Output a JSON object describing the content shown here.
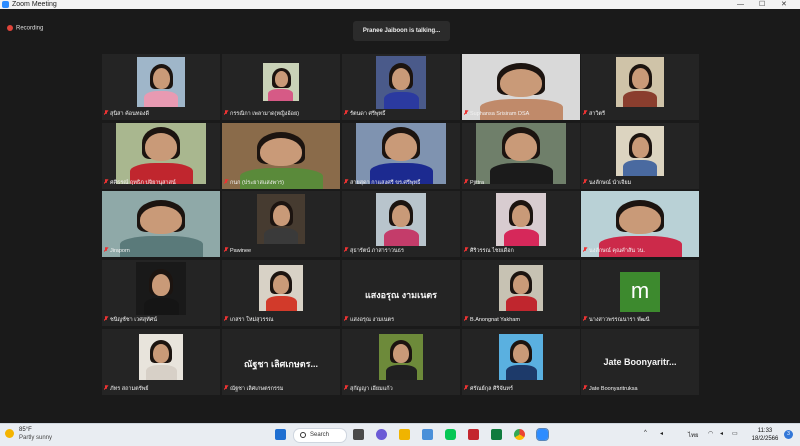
{
  "window": {
    "title": "Zoom Meeting",
    "controls": [
      "—",
      "☐",
      "✕"
    ]
  },
  "recording": {
    "label": "Recording"
  },
  "speaker_banner": "Pranee Jaiboon is talking...",
  "participants": [
    {
      "name": "สุนิสา ค้อนทองดี",
      "muted": true,
      "video": true
    },
    {
      "name": "กรรณิกา เพลามาด(หญิงอ้อย)",
      "muted": true,
      "video": true
    },
    {
      "name": "รัตนดา ศรีพุทธิ์",
      "muted": true,
      "video": true
    },
    {
      "name": "Suphansa Srisiram DSA",
      "muted": true,
      "video": true
    },
    {
      "name": "สาวิตรี",
      "muted": true,
      "video": true
    },
    {
      "name": "ศศิธร​ณ์ ฤทธิภ ปจิยานุสาสน์",
      "muted": true,
      "video": true
    },
    {
      "name": "กนก (ประยาสแสงพาร)",
      "muted": true,
      "video": true
    },
    {
      "name": "สายสุดา กาแสงศรี ขร.ศรีพุทธิ์",
      "muted": true,
      "video": true
    },
    {
      "name": "Pjittra",
      "muted": true,
      "video": true
    },
    {
      "name": "นงลักษณ์ น่ำเจียม",
      "muted": true,
      "video": true
    },
    {
      "name": "Jiraporn",
      "muted": true,
      "video": true
    },
    {
      "name": "Pawinee",
      "muted": true,
      "video": true
    },
    {
      "name": "สุธารัตน์ ภาสาราวนธร",
      "muted": true,
      "video": true
    },
    {
      "name": "ศิริวรรณ ไชยเดือก",
      "muted": true,
      "video": true
    },
    {
      "name": "นงลักษณ์ คุณคำสัน วน.",
      "muted": true,
      "video": true
    },
    {
      "name": "ชนิญช์ชา เวศสุทัศน์",
      "muted": true,
      "video": true
    },
    {
      "name": "เกสรา ใหม่สุวรรณ",
      "muted": true,
      "video": true
    },
    {
      "name": "แสงอรุณ งามเนตร",
      "muted": true,
      "video": false,
      "display": "แสงอรุณ งามเนตร"
    },
    {
      "name": "B.Anongnat Yakham",
      "muted": true,
      "video": true
    },
    {
      "name": "นางสาวพรรณนารา พัฒนี",
      "muted": true,
      "video": false,
      "initial": "m"
    },
    {
      "name": "ภัทร สถามตรัพย์",
      "muted": true,
      "video": true
    },
    {
      "name": "ณัฐชา เลิศเกษตรกรรม",
      "muted": true,
      "video": false,
      "display": "ณัฐชา เลิศเกษตร..."
    },
    {
      "name": "สุกัญญา เอี่ยมแก้ว",
      "muted": true,
      "video": true
    },
    {
      "name": "ศรัณย์กุล ศิริจันทร์",
      "muted": true,
      "video": true
    },
    {
      "name": "Jate Boonyaritruksa",
      "muted": true,
      "video": false,
      "display": "Jate  Boonyaritr..."
    }
  ],
  "taskbar": {
    "weather_temp": "85°F",
    "weather_desc": "Partly sunny",
    "search_label": "Search",
    "lang": "ไทย",
    "time": "11:33",
    "date": "18/2/2566",
    "notification_count": "3"
  }
}
